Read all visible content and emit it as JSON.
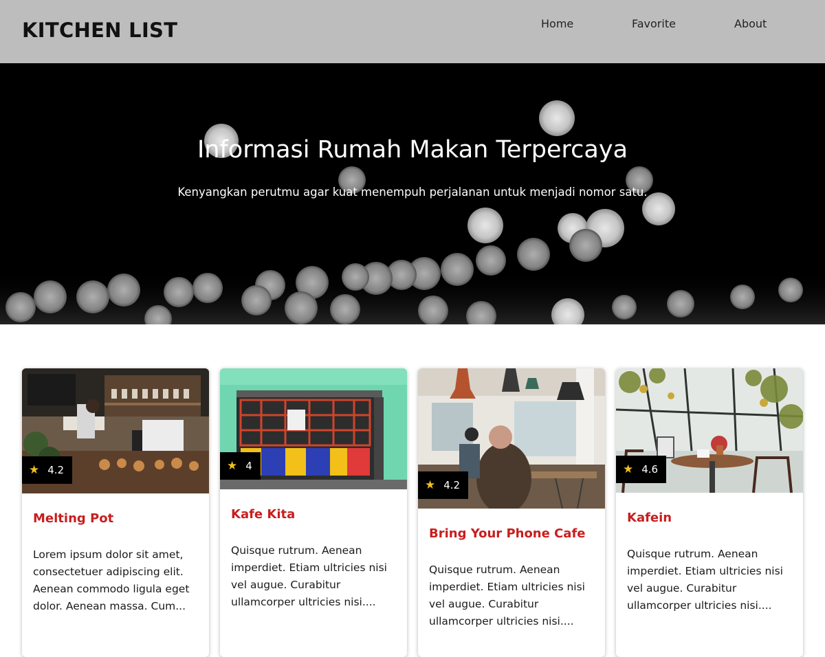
{
  "header": {
    "brand": "KITCHEN LIST",
    "nav": [
      "Home",
      "Favorite",
      "About"
    ]
  },
  "hero": {
    "title": "Informasi Rumah Makan Terpercaya",
    "subtitle": "Kenyangkan perutmu agar kuat menempuh perjalanan untuk menjadi nomor satu."
  },
  "colors": {
    "header_bg": "#bdbdbd",
    "hero_bg": "#000000",
    "card_title": "#c81e1e",
    "star": "#f2c01e",
    "rating_badge": "#000000"
  },
  "restaurants": [
    {
      "name": "Melting Pot",
      "rating": "4.2",
      "image_icon": "cafe-counter-photo",
      "description_lines": [
        "Lorem ipsum dolor sit amet,",
        "consectetuer adipiscing elit.",
        "Aenean commodo ligula eget",
        "dolor. Aenean massa. Cum..."
      ]
    },
    {
      "name": "Kafe Kita",
      "rating": "4",
      "image_icon": "storefront-photo",
      "description_lines": [
        "Quisque rutrum. Aenean",
        "imperdiet. Etiam ultricies nisi",
        "vel augue. Curabitur",
        "ullamcorper ultricies nisi...."
      ]
    },
    {
      "name": "Bring Your Phone Cafe",
      "rating": "4.2",
      "image_icon": "cafe-interior-photo",
      "description_lines": [
        "Quisque rutrum. Aenean",
        "imperdiet. Etiam ultricies nisi",
        "vel augue. Curabitur",
        "ullamcorper ultricies nisi...."
      ]
    },
    {
      "name": "Kafein",
      "rating": "4.6",
      "image_icon": "greenhouse-cafe-photo",
      "description_lines": [
        "Quisque rutrum. Aenean",
        "imperdiet. Etiam ultricies nisi",
        "vel augue. Curabitur",
        "ullamcorper ultricies nisi...."
      ]
    }
  ]
}
